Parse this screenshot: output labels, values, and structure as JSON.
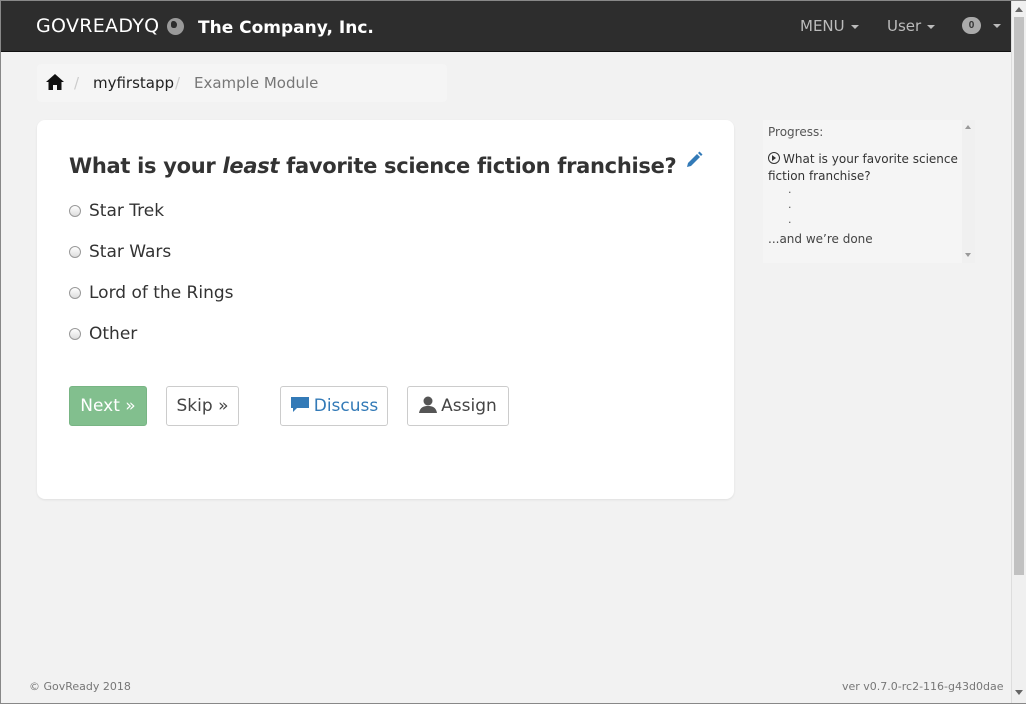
{
  "navbar": {
    "brand": "GOVREADYQ",
    "company": "The Company, Inc.",
    "menu_label": "MENU",
    "user_label": "User",
    "notification_count": "0"
  },
  "breadcrumb": {
    "items": [
      "myfirstapp",
      "Example Module"
    ]
  },
  "question": {
    "prefix": "What is your ",
    "emphasis": "least",
    "suffix": " favorite science fiction franchise?",
    "choices": [
      "Star Trek",
      "Star Wars",
      "Lord of the Rings",
      "Other"
    ],
    "buttons": {
      "next": "Next »",
      "skip": "Skip »",
      "discuss": "Discuss",
      "assign": "Assign"
    }
  },
  "progress": {
    "label": "Progress:",
    "current_step": "What is your favorite science fiction franchise?",
    "dots": [
      ".",
      ".",
      "."
    ],
    "end": "...and we’re done"
  },
  "footer": {
    "copyright": "© GovReady 2018",
    "version": "ver v0.7.0-rc2-116-g43d0dae"
  },
  "colors": {
    "navbar_bg": "#2d2d2d",
    "next_button": "#82bf8e",
    "link_blue": "#337ab7"
  }
}
